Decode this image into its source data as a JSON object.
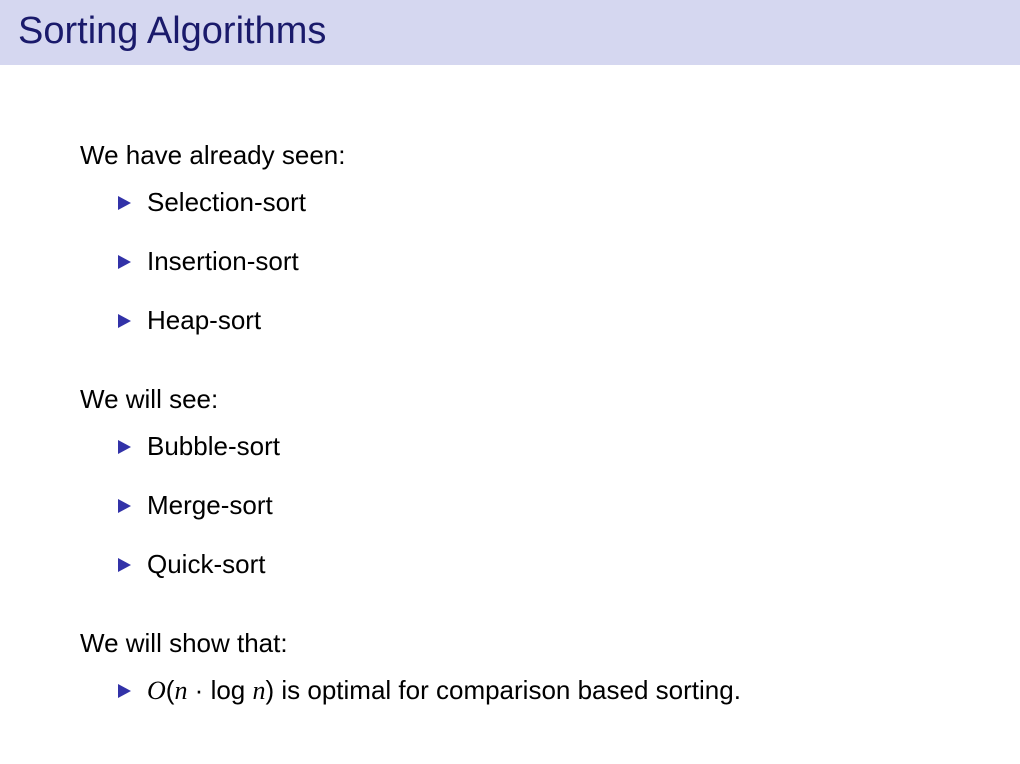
{
  "title": "Sorting Algorithms",
  "section1": {
    "heading": "We have already seen:",
    "items": [
      "Selection-sort",
      "Insertion-sort",
      "Heap-sort"
    ]
  },
  "section2": {
    "heading": "We will see:",
    "items": [
      "Bubble-sort",
      "Merge-sort",
      "Quick-sort"
    ]
  },
  "section3": {
    "heading": "We will show that:",
    "formula_O": "O",
    "formula_open": "(",
    "formula_n1": "n",
    "formula_dot": " · ",
    "formula_log": "log ",
    "formula_n2": "n",
    "formula_close": ")",
    "formula_rest": " is optimal for comparison based sorting."
  }
}
